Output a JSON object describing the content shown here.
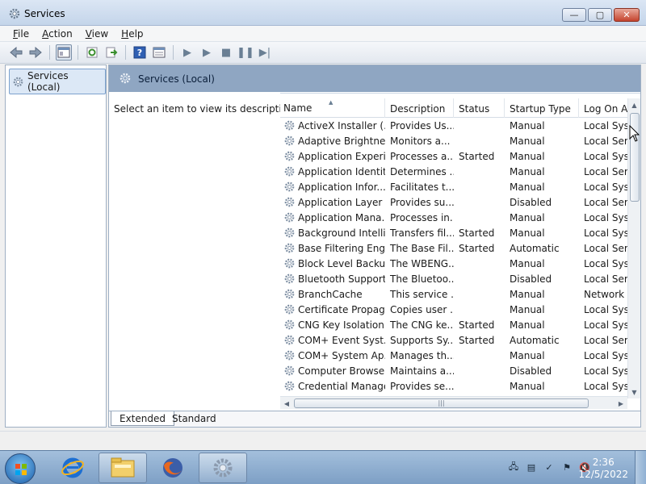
{
  "window": {
    "title": "Services",
    "buttons": {
      "minimize": "—",
      "maximize": "▢",
      "close": "✕"
    }
  },
  "menu": {
    "items": [
      {
        "label": "File",
        "accel": "F",
        "rest": "ile"
      },
      {
        "label": "Action",
        "accel": "A",
        "rest": "ction"
      },
      {
        "label": "View",
        "accel": "V",
        "rest": "iew"
      },
      {
        "label": "Help",
        "accel": "H",
        "rest": "elp"
      }
    ]
  },
  "toolbar": {
    "back": "◀",
    "forward": "▶",
    "help": "?",
    "play": "▶",
    "play2": "▶",
    "stop": "■",
    "pause": "❚❚",
    "restart": "▶|"
  },
  "tree": {
    "root": "Services (Local)"
  },
  "panel": {
    "title": "Services (Local)",
    "description": "Select an item to view its description."
  },
  "table": {
    "columns": [
      "Name",
      "Description",
      "Status",
      "Startup Type",
      "Log On A"
    ],
    "rows": [
      [
        "ActiveX Installer (...",
        "Provides Us...",
        "",
        "Manual",
        "Local Syst"
      ],
      [
        "Adaptive Brightness",
        "Monitors a...",
        "",
        "Manual",
        "Local Serv"
      ],
      [
        "Application Experi...",
        "Processes a...",
        "Started",
        "Manual",
        "Local Syst"
      ],
      [
        "Application Identity",
        "Determines ...",
        "",
        "Manual",
        "Local Serv"
      ],
      [
        "Application Infor...",
        "Facilitates t...",
        "",
        "Manual",
        "Local Syst"
      ],
      [
        "Application Layer ...",
        "Provides su...",
        "",
        "Disabled",
        "Local Serv"
      ],
      [
        "Application Mana...",
        "Processes in...",
        "",
        "Manual",
        "Local Syst"
      ],
      [
        "Background Intelli...",
        "Transfers fil...",
        "Started",
        "Manual",
        "Local Syst"
      ],
      [
        "Base Filtering Engi...",
        "The Base Fil...",
        "Started",
        "Automatic",
        "Local Serv"
      ],
      [
        "Block Level Backu...",
        "The WBENG...",
        "",
        "Manual",
        "Local Syst"
      ],
      [
        "Bluetooth Support...",
        "The Bluetoo...",
        "",
        "Disabled",
        "Local Serv"
      ],
      [
        "BranchCache",
        "This service ...",
        "",
        "Manual",
        "Network S"
      ],
      [
        "Certificate Propag...",
        "Copies user ...",
        "",
        "Manual",
        "Local Syst"
      ],
      [
        "CNG Key Isolation",
        "The CNG ke...",
        "Started",
        "Manual",
        "Local Syst"
      ],
      [
        "COM+ Event Syst...",
        "Supports Sy...",
        "Started",
        "Automatic",
        "Local Serv"
      ],
      [
        "COM+ System Ap...",
        "Manages th...",
        "",
        "Manual",
        "Local Syst"
      ],
      [
        "Computer Browser",
        "Maintains a...",
        "",
        "Disabled",
        "Local Syst"
      ],
      [
        "Credential Manager",
        "Provides se...",
        "",
        "Manual",
        "Local Syst"
      ]
    ]
  },
  "tabs": {
    "extended": "Extended",
    "standard": "Standard"
  },
  "scroll": {
    "vertical_position": 0.0,
    "horizontal_grip": "|||"
  },
  "taskbar": {
    "clock_time": "2:36",
    "clock_date": "12/5/2022",
    "apps": [
      "start-orb",
      "internet-explorer-icon",
      "windows-explorer-icon",
      "firefox-icon",
      "services-icon"
    ],
    "tray": [
      "network-icon",
      "document-icon",
      "security-icon",
      "flag-icon",
      "volume-muted-icon"
    ]
  },
  "colors": {
    "banner": "#8fa6c2",
    "taskbar": "#7d9fc5",
    "close_button": "#c4432d"
  }
}
